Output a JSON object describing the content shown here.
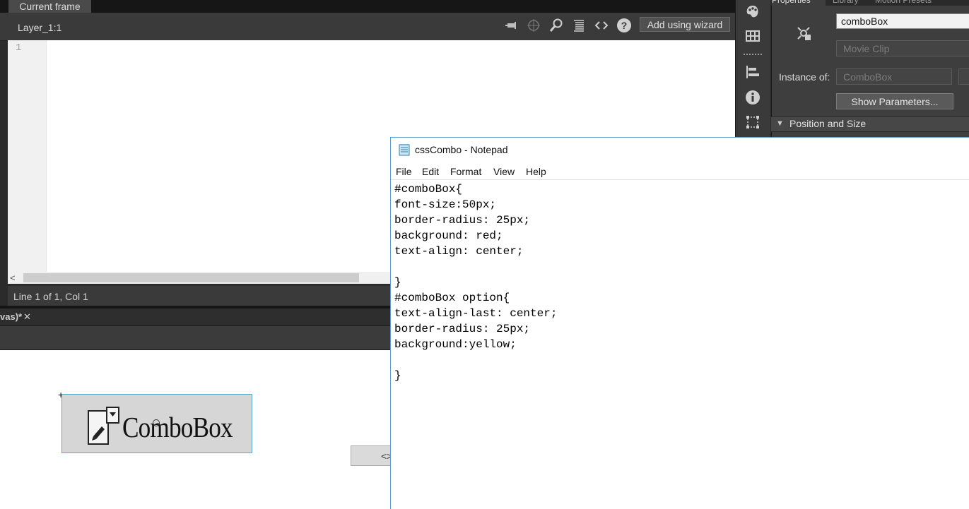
{
  "actions_panel": {
    "frame_tab": "Current frame",
    "layer_label": "Layer_1:1",
    "wizard_button": "Add using wizard",
    "line_number": "1",
    "status": "Line 1 of 1, Col 1",
    "toolbar_icons": [
      "pin-icon",
      "target-icon",
      "search-icon",
      "format-icon",
      "code-icon",
      "help-icon"
    ]
  },
  "document": {
    "tab_label": "vas)*",
    "close_glyph": "✕",
    "combobox_label": "ComboBox",
    "code_chip": "<>"
  },
  "properties": {
    "tabs": [
      "Properties",
      "Library",
      "Motion Presets"
    ],
    "instance_name": "comboBox",
    "symbol_type": "Movie Clip",
    "instance_of_label": "Instance of:",
    "instance_of_value": "ComboBox",
    "show_params_button": "Show Parameters...",
    "position_size_section": "Position and Size"
  },
  "right_tools": [
    "palette-icon",
    "grid-icon",
    "align-icon",
    "info-icon",
    "transform-icon"
  ],
  "notepad": {
    "title": "cssCombo - Notepad",
    "menu": [
      "File",
      "Edit",
      "Format",
      "View",
      "Help"
    ],
    "content": "#comboBox{\nfont-size:50px;\nborder-radius: 25px;\nbackground: red;\ntext-align: center;\n\n}\n#comboBox option{\ntext-align-last: center;\nborder-radius: 25px;\nbackground:yellow;\n\n}"
  },
  "colors": {
    "panel_dark": "#2b2b2b",
    "selection_border": "#59a8c6",
    "notepad_border": "#5c9bd1"
  }
}
